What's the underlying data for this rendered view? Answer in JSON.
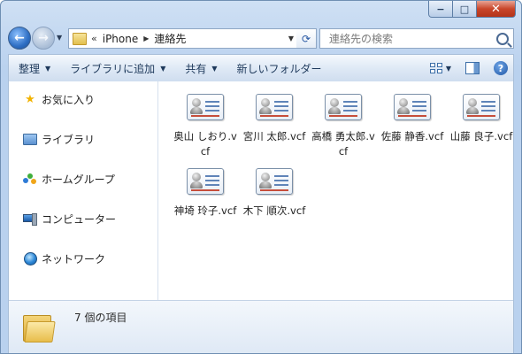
{
  "window": {
    "caption_buttons": {
      "minimize": "−",
      "maximize": "□",
      "close": "✕"
    }
  },
  "address": {
    "overflow": "«",
    "crumbs": [
      "iPhone",
      "連絡先"
    ]
  },
  "search": {
    "placeholder": "連絡先の検索"
  },
  "toolbar": {
    "organize": "整理",
    "add_to_library": "ライブラリに追加",
    "share": "共有",
    "new_folder": "新しいフォルダー",
    "help": "?"
  },
  "nav": {
    "items": [
      {
        "label": "お気に入り",
        "icon": "star-icon"
      },
      {
        "label": "ライブラリ",
        "icon": "library-icon"
      },
      {
        "label": "ホームグループ",
        "icon": "homegroup-icon"
      },
      {
        "label": "コンピューター",
        "icon": "computer-icon"
      },
      {
        "label": "ネットワーク",
        "icon": "network-icon"
      }
    ]
  },
  "files": [
    {
      "name": "奥山 しおり.vcf"
    },
    {
      "name": "宮川 太郎.vcf"
    },
    {
      "name": "高橋 勇太郎.vcf"
    },
    {
      "name": "佐藤 静香.vcf"
    },
    {
      "name": "山藤 良子.vcf"
    },
    {
      "name": "神埼 玲子.vcf"
    },
    {
      "name": "木下 順次.vcf"
    }
  ],
  "details": {
    "item_count": "7 個の項目"
  }
}
